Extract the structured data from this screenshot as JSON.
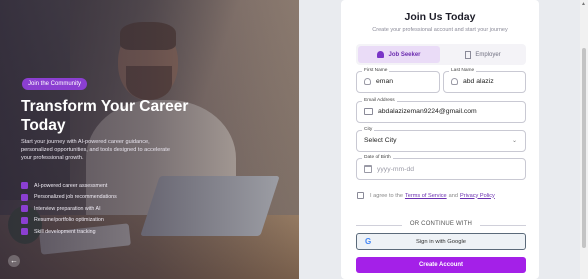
{
  "hero": {
    "pill": "Join the Community",
    "title": "Transform Your Career Today",
    "description": "Start your journey with AI-powered career guidance, personalized opportunities, and tools designed to accelerate your professional growth.",
    "features": [
      "AI-powered career assessment",
      "Personalized job recommendations",
      "Interview preparation with AI",
      "Resume/portfolio optimization",
      "Skill development tracking"
    ],
    "back_icon": "arrow-left-icon"
  },
  "form": {
    "title": "Join Us Today",
    "subtitle": "Create your professional account and start your journey",
    "roles": {
      "job_seeker": "Job Seeker",
      "employer": "Employer"
    },
    "first_name": {
      "label": "First Name",
      "value": "eman"
    },
    "last_name": {
      "label": "Last Name",
      "value": "abd alaziz"
    },
    "email": {
      "label": "Email Address",
      "value": "abdalazizeman9224@gmail.com"
    },
    "city": {
      "label": "City",
      "value": "Select City"
    },
    "dob": {
      "label": "Date of Birth",
      "placeholder": "yyyy-mm-dd"
    },
    "terms": {
      "prefix": "I agree to the",
      "tos": "Terms of Service",
      "and": "and",
      "privacy": "Privacy Policy"
    },
    "divider": "OR CONTINUE WITH",
    "google": "Sign in with Google",
    "create": "Create Account"
  },
  "colors": {
    "accent": "#a420e8",
    "accent_dark": "#6c2db0"
  }
}
